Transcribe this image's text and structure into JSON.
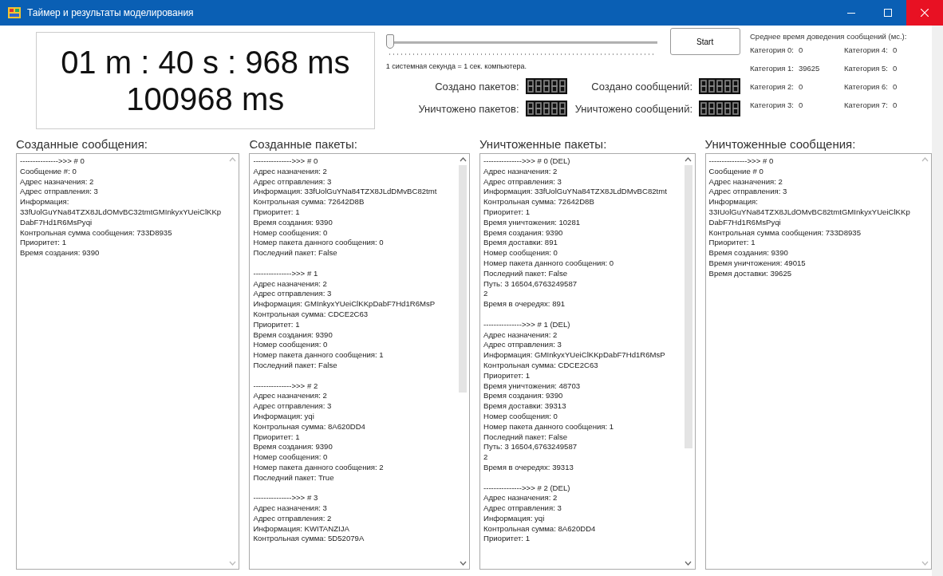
{
  "window": {
    "title": "Таймер и результаты моделирования"
  },
  "timer": {
    "clock": "01 m : 40 s : 968 ms",
    "total": "100968 ms"
  },
  "speed_slider": {
    "level": 0,
    "caption": "1 системная секунда = 1 сек. компьютера."
  },
  "start_button": "Start",
  "counters": [
    {
      "label": "Создано пакетов:"
    },
    {
      "label": "Создано сообщений:"
    },
    {
      "label": "Уничтожено пакетов:"
    },
    {
      "label": "Уничтожено сообщений:"
    }
  ],
  "averages": {
    "title": "Среднее время доведения сообщений (мс.):",
    "categories": [
      {
        "label": "Категория 0:",
        "value": "0"
      },
      {
        "label": "Категория 4:",
        "value": "0"
      },
      {
        "label": "Категория 1:",
        "value": "39625"
      },
      {
        "label": "Категория 5:",
        "value": "0"
      },
      {
        "label": "Категория 2:",
        "value": "0"
      },
      {
        "label": "Категория 6:",
        "value": "0"
      },
      {
        "label": "Категория 3:",
        "value": "0"
      },
      {
        "label": "Категория 7:",
        "value": "0"
      }
    ]
  },
  "panels": [
    {
      "title": "Созданные сообщения:",
      "entries": [
        {
          "lines": [
            "--------------->>> # 0",
            "Сообщение #: 0",
            "Адрес назначения: 2",
            "Адрес отправления: 3",
            "Информация:",
            "33fUolGuYNa84TZX8JLdOMvBC32tmtGMInkyxYUeiClKKp",
            "DabF7Hd1R6MsPyqi",
            "Контрольная сумма сообщения: 733D8935",
            "Приоритет: 1",
            "Время создания: 9390"
          ]
        }
      ]
    },
    {
      "title": "Созданные пакеты:",
      "entries": [
        {
          "lines": [
            "--------------->>> # 0",
            "Адрес назначения: 2",
            "Адрес отправления: 3",
            "Информация: 33fUolGuYNa84TZX8JLdDMvBC82tmt",
            "Контрольная сумма: 72642D8B",
            "Приоритет: 1",
            "Время создания: 9390",
            "Номер сообщения: 0",
            "Номер пакета данного сообщения: 0",
            "Последний пакет: False"
          ]
        },
        {
          "lines": [
            "--------------->>> # 1",
            "Адрес назначения: 2",
            "Адрес отправления: 3",
            "Информация: GMInkyxYUeiClKKpDabF7Hd1R6MsP",
            "Контрольная сумма: CDCE2C63",
            "Приоритет: 1",
            "Время создания: 9390",
            "Номер сообщения: 0",
            "Номер пакета данного сообщения: 1",
            "Последний пакет: False"
          ]
        },
        {
          "lines": [
            "--------------->>> # 2",
            "Адрес назначения: 2",
            "Адрес отправления: 3",
            "Информация: yqi",
            "Контрольная сумма: 8A620DD4",
            "Приоритет: 1",
            "Время создания: 9390",
            "Номер сообщения: 0",
            "Номер пакета данного сообщения: 2",
            "Последний пакет: True"
          ]
        },
        {
          "lines": [
            "--------------->>> # 3",
            "Адрес назначения: 3",
            "Адрес отправления: 2",
            "Информация: KWITANZIJA",
            "Контрольная сумма: 5D52079A"
          ]
        }
      ]
    },
    {
      "title": "Уничтоженные пакеты:",
      "entries": [
        {
          "lines": [
            "--------------->>> # 0 (DEL)",
            "Адрес назначения: 2",
            "Адрес отправления: 3",
            "Информация: 33fUolGuYNa84TZX8JLdDMvBC82tmt",
            "Контрольная сумма: 72642D8B",
            "Приоритет: 1",
            "Время уничтожения: 10281",
            "Время создания: 9390",
            "Время доставки: 891",
            "Номер сообщения: 0",
            "Номер пакета данного сообщения: 0",
            "Последний пакет: False",
            "Путь: 3 16504,6763249587",
            "2",
            "Время в очередях: 891"
          ]
        },
        {
          "lines": [
            "--------------->>> # 1 (DEL)",
            "Адрес назначения: 2",
            "Адрес отправления: 3",
            "Информация: GMInkyxYUeiClKKpDabF7Hd1R6MsP",
            "Контрольная сумма: CDCE2C63",
            "Приоритет: 1",
            "Время уничтожения: 48703",
            "Время создания: 9390",
            "Время доставки: 39313",
            "Номер сообщения: 0",
            "Номер пакета данного сообщения: 1",
            "Последний пакет: False",
            "Путь: 3 16504,6763249587",
            "2",
            "Время в очередях: 39313"
          ]
        },
        {
          "lines": [
            "--------------->>> # 2 (DEL)",
            "Адрес назначения: 2",
            "Адрес отправления: 3",
            "Информация: yqi",
            "Контрольная сумма: 8A620DD4",
            "Приоритет: 1"
          ]
        }
      ]
    },
    {
      "title": "Уничтоженные сообщения:",
      "entries": [
        {
          "lines": [
            "--------------->>> # 0",
            "Сообщение # 0",
            "Адрес назначения: 2",
            "Адрес отправления: 3",
            "Информация:",
            "33IUolGuYNa84TZX8JLdOMvBC82tmtGMInkyxYUeiClKKp",
            "DabF7Hd1R6MsPyqi",
            "Контрольная сумма сообщения: 733D8935",
            "Приоритет: 1",
            "Время создания: 9390",
            "Время уничтожения: 49015",
            "Время доставки: 39625"
          ]
        }
      ]
    }
  ]
}
